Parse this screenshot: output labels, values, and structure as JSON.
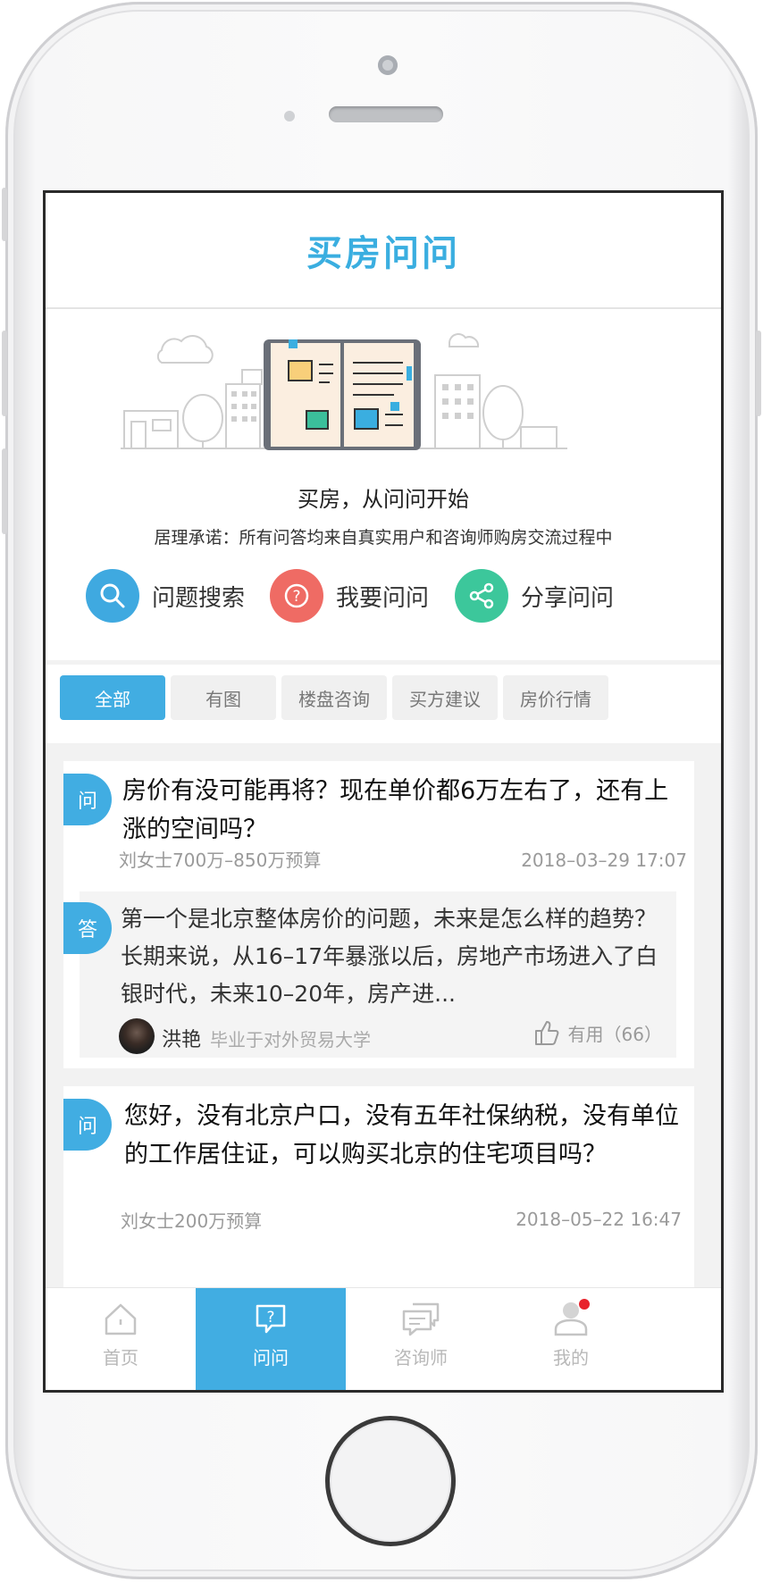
{
  "header": {
    "title": "买房问问"
  },
  "hero": {
    "tagline": "买房，从问问开始",
    "promise": "居理承诺：所有问答均来自真实用户和咨询师购房交流过程中"
  },
  "actions": [
    {
      "label": "问题搜索",
      "icon": "search-icon",
      "color": "#3fa9e0"
    },
    {
      "label": "我要问问",
      "icon": "question-icon",
      "color": "#ef6b64"
    },
    {
      "label": "分享问问",
      "icon": "share-icon",
      "color": "#3cc79b"
    }
  ],
  "filter_tabs": [
    {
      "label": "全部",
      "active": true
    },
    {
      "label": "有图",
      "active": false
    },
    {
      "label": "楼盘咨询",
      "active": false
    },
    {
      "label": "买方建议",
      "active": false
    },
    {
      "label": "房价行情",
      "active": false
    }
  ],
  "questions": [
    {
      "badge": "问",
      "text": "房价有没可能再将？现在单价都6万左右了，还有上涨的空间吗？",
      "asker": "刘女士700万–850万预算",
      "time": "2018–03–29 17:07",
      "answer": {
        "badge": "答",
        "text": "第一个是北京整体房价的问题，未来是怎么样的趋势？长期来说，从16–17年暴涨以后，房地产市场进入了白银时代，未来10–20年，房产进...",
        "author": "洪艳",
        "school": "毕业于对外贸易大学",
        "useful": "有用（66）"
      }
    },
    {
      "badge": "问",
      "text": "您好，没有北京户口，没有五年社保纳税，没有单位的工作居住证，可以购买北京的住宅项目吗？",
      "asker": "刘女士200万预算",
      "time": "2018–05–22 16:47"
    }
  ],
  "bottom_nav": [
    {
      "label": "首页",
      "icon": "home-icon",
      "active": false
    },
    {
      "label": "问问",
      "icon": "ask-icon",
      "active": true
    },
    {
      "label": "咨询师",
      "icon": "chat-icon",
      "active": false
    },
    {
      "label": "我的",
      "icon": "profile-icon",
      "active": false,
      "notification": true
    }
  ],
  "colors": {
    "accent": "#41ade2",
    "notification": "#e8222b"
  }
}
